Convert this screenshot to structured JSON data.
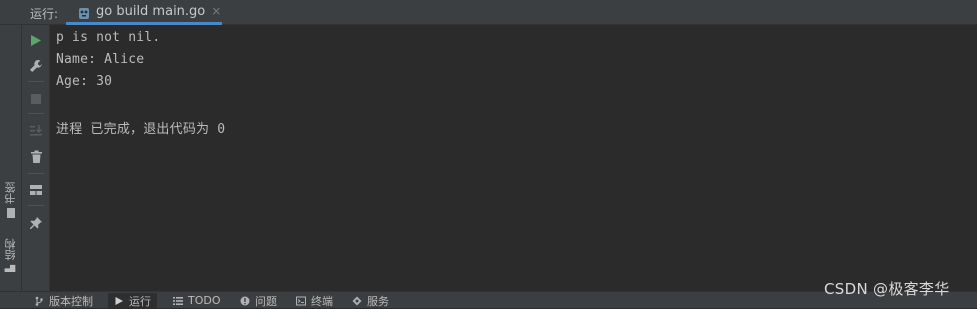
{
  "run_panel": {
    "label": "运行:",
    "tab": {
      "title": "go build main.go",
      "close": "×"
    }
  },
  "console": {
    "lines": [
      "p is not nil.",
      "Name: Alice",
      "Age: 30",
      "",
      "进程 已完成，退出代码为 0"
    ]
  },
  "left_rail": {
    "bookmarks": "书签",
    "structure": "结构"
  },
  "status_bar": {
    "items": [
      "版本控制",
      "运行",
      "TODO",
      "问题",
      "终端",
      "服务"
    ],
    "active_index": 1
  },
  "watermark": "CSDN @极客李华",
  "colors": {
    "accent": "#4a88c7",
    "run_green": "#59a869",
    "console_bg": "#2b2b2b",
    "panel_bg": "#3c3f41"
  }
}
